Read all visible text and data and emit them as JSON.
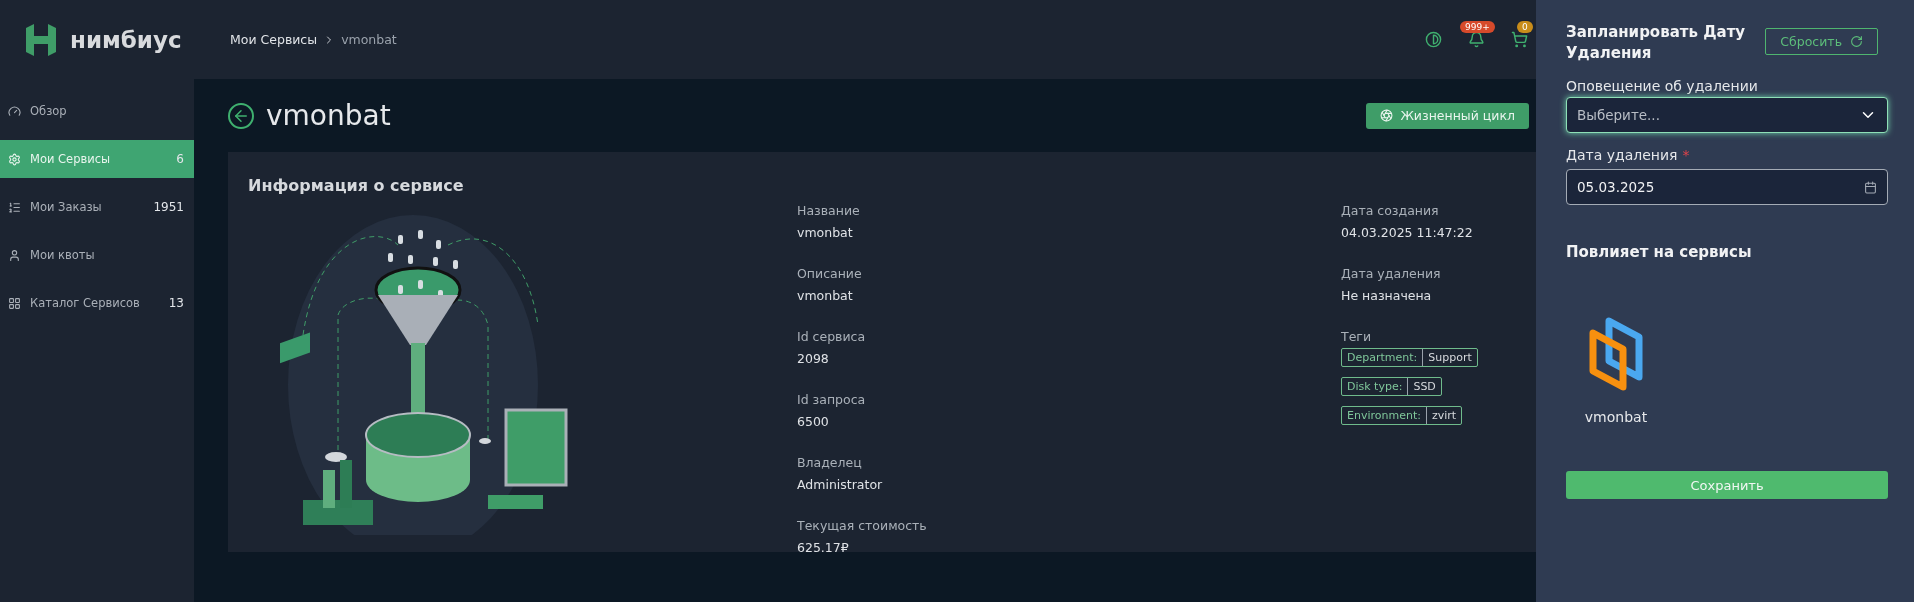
{
  "brand": {
    "name": "нимбиус"
  },
  "sidebar": {
    "items": [
      {
        "label": "Обзор",
        "kind": "gauge",
        "selected": false
      },
      {
        "label": "Мои Сервисы",
        "kind": "gear",
        "count": "6",
        "selected": true
      },
      {
        "label": "Мои Заказы",
        "kind": "list",
        "count": "1951",
        "selected": false
      },
      {
        "label": "Мои квоты",
        "kind": "user",
        "selected": false
      },
      {
        "label": "Каталог Сервисов",
        "kind": "grid",
        "count": "13",
        "selected": false
      }
    ]
  },
  "breadcrumbs": [
    {
      "label": "Мои Сервисы",
      "current": false
    },
    {
      "label": "vmonbat",
      "current": true
    }
  ],
  "header_badges": {
    "notifications": "999+",
    "cart": "0"
  },
  "page": {
    "title": "vmonbat",
    "lifecycle_button": "Жизненный цикл"
  },
  "info_card": {
    "title": "Информация о сервисе",
    "left_fields": [
      {
        "label": "Название",
        "value": "vmonbat"
      },
      {
        "label": "Описание",
        "value": "vmonbat"
      },
      {
        "label": "Id сервиса",
        "value": "2098"
      },
      {
        "label": "Id запроса",
        "value": "6500"
      },
      {
        "label": "Владелец",
        "value": "Administrator"
      },
      {
        "label": "Текущая стоимость",
        "value": "625.17₽"
      }
    ],
    "right_fields": [
      {
        "label": "Дата создания",
        "value": "04.03.2025 11:47:22"
      },
      {
        "label": "Дата удаления",
        "value": "Не назначена"
      }
    ],
    "tags_label": "Теги",
    "tags": [
      {
        "key": "Department:",
        "value": "Support"
      },
      {
        "key": "Disk type:",
        "value": "SSD"
      },
      {
        "key": "Environment:",
        "value": "zvirt"
      }
    ]
  },
  "panel": {
    "title": "Запланировать Дату Удаления",
    "reset_button": "Сбросить",
    "notice_field": {
      "label": "Оповещение об удалении",
      "placeholder": "Выберите...",
      "focused": true
    },
    "date_field": {
      "label": "Дата удаления",
      "required_mark": "*",
      "value": "05.03.2025"
    },
    "affected_title": "Повлияет на сервисы",
    "services": [
      {
        "name": "vmonbat"
      }
    ],
    "save_button": "Сохранить"
  }
}
